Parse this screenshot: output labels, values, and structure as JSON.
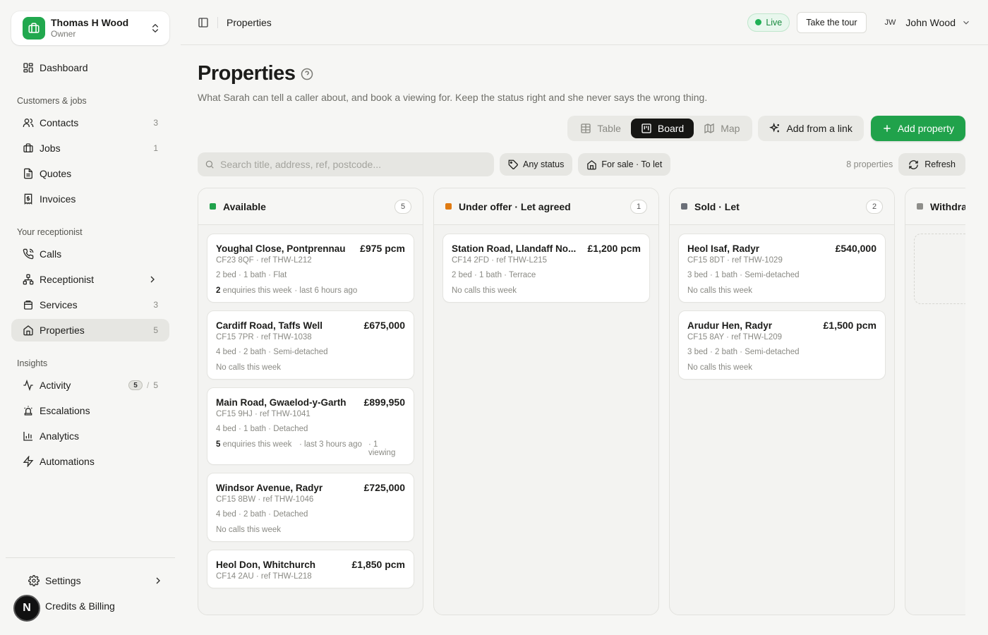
{
  "org": {
    "name": "Thomas H Wood",
    "role": "Owner"
  },
  "nav": {
    "dashboard": "Dashboard",
    "section_customers": "Customers & jobs",
    "contacts": {
      "label": "Contacts",
      "count": "3"
    },
    "jobs": {
      "label": "Jobs",
      "count": "1"
    },
    "quotes": "Quotes",
    "invoices": "Invoices",
    "section_receptionist": "Your receptionist",
    "calls": "Calls",
    "receptionist": "Receptionist",
    "services": {
      "label": "Services",
      "count": "3"
    },
    "properties": {
      "label": "Properties",
      "count": "5"
    },
    "section_insights": "Insights",
    "activity": {
      "label": "Activity",
      "badge": "5",
      "separator": "/",
      "total": "5"
    },
    "escalations": "Escalations",
    "analytics": "Analytics",
    "automations": "Automations",
    "settings": "Settings",
    "billing": "Credits & Billing",
    "avatar_letter": "N"
  },
  "topbar": {
    "breadcrumb": "Properties",
    "live": "Live",
    "tour": "Take the tour",
    "user_initials": "JW",
    "user_name": "John Wood"
  },
  "page": {
    "title": "Properties",
    "subtitle": "What Sarah can tell a caller about, and book a viewing for. Keep the status right and she never says the wrong thing."
  },
  "views": {
    "table": "Table",
    "board": "Board",
    "map": "Map",
    "active": "board"
  },
  "actions": {
    "add_link": "Add from a link",
    "add_property": "Add property"
  },
  "filters": {
    "search_placeholder": "Search title, address, ref, postcode...",
    "status": "Any status",
    "type": "For sale · To let",
    "count": "8 properties",
    "refresh": "Refresh"
  },
  "colors": {
    "accent": "#20a24b",
    "available": "#20a24b",
    "under_offer": "#e07b12",
    "sold": "#6b6f78",
    "withdrawn": "#8e8e8a"
  },
  "columns": [
    {
      "title": "Available",
      "count": "5",
      "color": "#20a24b",
      "cards": [
        {
          "title": "Youghal Close, Pontprennau",
          "price": "£975 pcm",
          "ref": "CF23 8QF · ref THW-L212",
          "spec": "2 bed · 1 bath · Flat",
          "stat_count": "2",
          "stat_text": " enquiries this week",
          "stat_last": " · last 6 hours ago",
          "stat_view": ""
        },
        {
          "title": "Cardiff Road, Taffs Well",
          "price": "£675,000",
          "ref": "CF15 7PR · ref THW-1038",
          "spec": "4 bed · 2 bath · Semi-detached",
          "stat_count": "",
          "stat_text": "No calls this week",
          "stat_last": "",
          "stat_view": ""
        },
        {
          "title": "Main Road, Gwaelod-y-Garth",
          "price": "£899,950",
          "ref": "CF15 9HJ · ref THW-1041",
          "spec": "4 bed · 1 bath · Detached",
          "stat_count": "5",
          "stat_text": " enquiries this week",
          "stat_last": "· last 3 hours ago",
          "stat_view": "· 1 viewing"
        },
        {
          "title": "Windsor Avenue, Radyr",
          "price": "£725,000",
          "ref": "CF15 8BW · ref THW-1046",
          "spec": "4 bed · 2 bath · Detached",
          "stat_count": "",
          "stat_text": "No calls this week",
          "stat_last": "",
          "stat_view": ""
        },
        {
          "title": "Heol Don, Whitchurch",
          "price": "£1,850 pcm",
          "ref": "CF14 2AU · ref THW-L218",
          "spec": "",
          "stat_count": "",
          "stat_text": "",
          "stat_last": "",
          "stat_view": ""
        }
      ]
    },
    {
      "title": "Under offer · Let agreed",
      "count": "1",
      "color": "#e07b12",
      "cards": [
        {
          "title": "Station Road, Llandaff No...",
          "price": "£1,200 pcm",
          "ref": "CF14 2FD · ref THW-L215",
          "spec": "2 bed · 1 bath · Terrace",
          "stat_count": "",
          "stat_text": "No calls this week",
          "stat_last": "",
          "stat_view": ""
        }
      ]
    },
    {
      "title": "Sold · Let",
      "count": "2",
      "color": "#6b6f78",
      "cards": [
        {
          "title": "Heol Isaf, Radyr",
          "price": "£540,000",
          "ref": "CF15 8DT · ref THW-1029",
          "spec": "3 bed · 1 bath · Semi-detached",
          "stat_count": "",
          "stat_text": "No calls this week",
          "stat_last": "",
          "stat_view": ""
        },
        {
          "title": "Arudur Hen, Radyr",
          "price": "£1,500 pcm",
          "ref": "CF15 8AY · ref THW-L209",
          "spec": "3 bed · 2 bath · Semi-detached",
          "stat_count": "",
          "stat_text": "No calls this week",
          "stat_last": "",
          "stat_view": ""
        }
      ]
    },
    {
      "title": "Withdra",
      "count": "",
      "color": "#8e8e8a",
      "cards": []
    }
  ]
}
